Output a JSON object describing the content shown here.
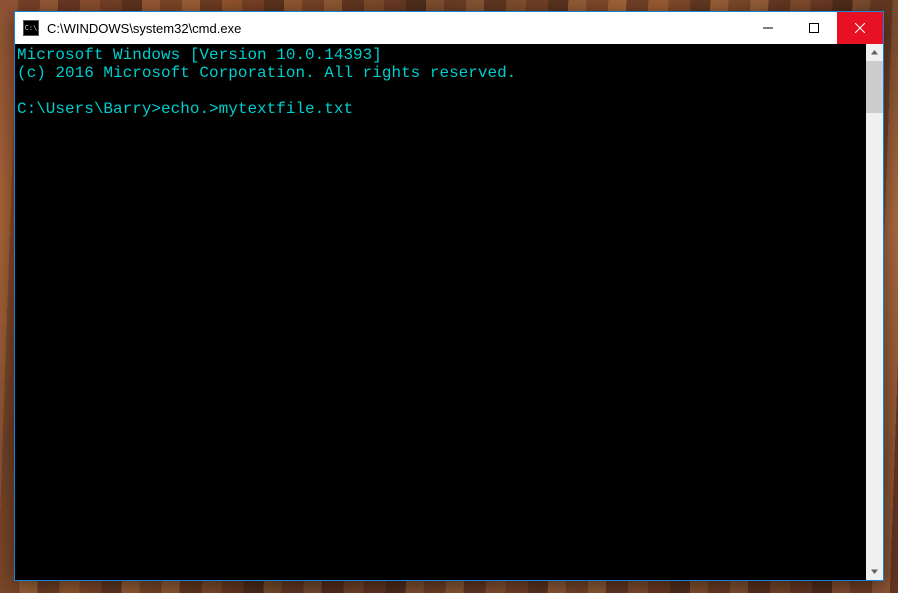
{
  "titlebar": {
    "title": "C:\\WINDOWS\\system32\\cmd.exe",
    "icon_char": "C:\\"
  },
  "console": {
    "line1": "Microsoft Windows [Version 10.0.14393]",
    "line2": "(c) 2016 Microsoft Corporation. All rights reserved.",
    "blank": "",
    "prompt": "C:\\Users\\Barry>",
    "command": "echo.>mytextfile.txt"
  },
  "colors": {
    "titlebar_accent": "#1883d7",
    "console_text": "#00cdcd",
    "close_bg": "#e81123"
  }
}
